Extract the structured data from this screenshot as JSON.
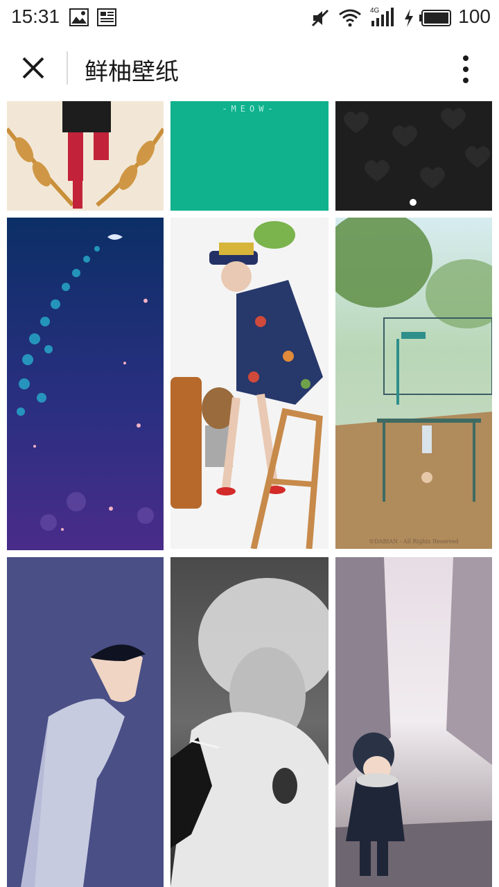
{
  "status_bar": {
    "time": "15:31",
    "battery_level": "100",
    "network_type": "4G",
    "icons": [
      "image-icon",
      "news-icon",
      "mute-icon",
      "wifi-icon",
      "signal-icon",
      "charging-icon",
      "battery-icon"
    ]
  },
  "toolbar": {
    "title": "鲜柚壁纸",
    "close_icon": "close-icon",
    "more_icon": "more-vertical-icon"
  },
  "wallpapers": {
    "meow_label": "-MEOW-",
    "copyright_label": "©DABIAN  -  All Rights Reserved",
    "tiles": [
      {
        "name": "wallpaper-illustration-laurel",
        "colors": [
          "#f2e7d6",
          "#c98f3b",
          "#c2233a"
        ]
      },
      {
        "name": "wallpaper-teal-meow",
        "colors": [
          "#0fb28d"
        ]
      },
      {
        "name": "wallpaper-dark-hearts",
        "colors": [
          "#1e1e1e",
          "#2b2b2b"
        ]
      },
      {
        "name": "wallpaper-starry-night-fish",
        "colors": [
          "#0c3a6e",
          "#3b2a7a",
          "#27a6c8"
        ]
      },
      {
        "name": "wallpaper-girl-floral-dress",
        "colors": [
          "#f4f4f4",
          "#27386b",
          "#c78a4a"
        ]
      },
      {
        "name": "wallpaper-playground-illustration",
        "colors": [
          "#bcd9c4",
          "#b08b5c",
          "#2f8f8b"
        ]
      },
      {
        "name": "wallpaper-blue-illustration-woman",
        "colors": [
          "#4a4f86",
          "#c7cbe0"
        ]
      },
      {
        "name": "wallpaper-bw-portrait-smoke",
        "colors": [
          "#1a1a1a",
          "#bdbdbd"
        ]
      },
      {
        "name": "wallpaper-child-street",
        "colors": [
          "#d6cfd6",
          "#2a3346",
          "#8a7f86"
        ]
      }
    ]
  }
}
